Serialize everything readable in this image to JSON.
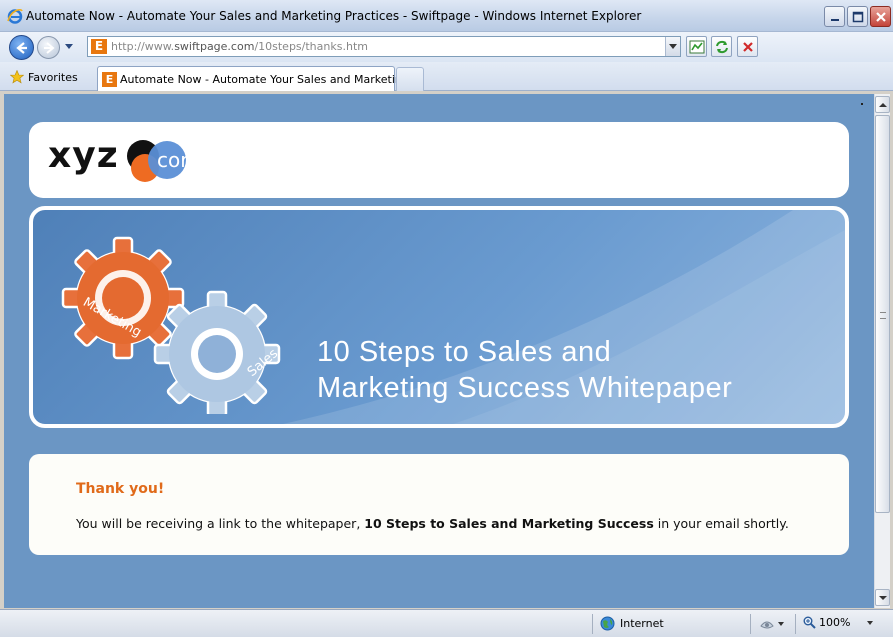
{
  "window": {
    "title": "Automate Now - Automate Your Sales and Marketing Practices - Swiftpage - Windows Internet Explorer"
  },
  "address_bar": {
    "url_prefix": "http://www.",
    "url_domain": "swiftpage.com",
    "url_path": "/10steps/thanks.htm"
  },
  "favorites": {
    "label": "Favorites"
  },
  "tab": {
    "label": "Automate Now - Automate Your Sales and Marketing ..."
  },
  "page": {
    "logo": {
      "text": "xyz",
      "corp": "corp"
    },
    "banner": {
      "gear1_label": "Marketing",
      "gear2_label": "Sales",
      "title_line1": "10 Steps to Sales and",
      "title_line2": "Marketing Success Whitepaper"
    },
    "message": {
      "heading": "Thank you!",
      "body_before": "You will be receiving a link to the whitepaper, ",
      "body_bold": "10 Steps to Sales and Marketing Success",
      "body_after": " in your email shortly."
    }
  },
  "status_bar": {
    "zone": "Internet",
    "zoom": "100%"
  },
  "colors": {
    "page_background": "#6b96c4",
    "accent_orange": "#e06a1a",
    "logo_orange": "#ee6b22",
    "logo_blue": "#5b8fd6"
  },
  "icons": [
    "ie-logo-icon",
    "back-arrow-icon",
    "forward-arrow-icon",
    "favorites-star-icon",
    "compatibility-view-icon",
    "refresh-icon",
    "stop-icon",
    "globe-icon",
    "protected-mode-icon",
    "zoom-icon"
  ]
}
